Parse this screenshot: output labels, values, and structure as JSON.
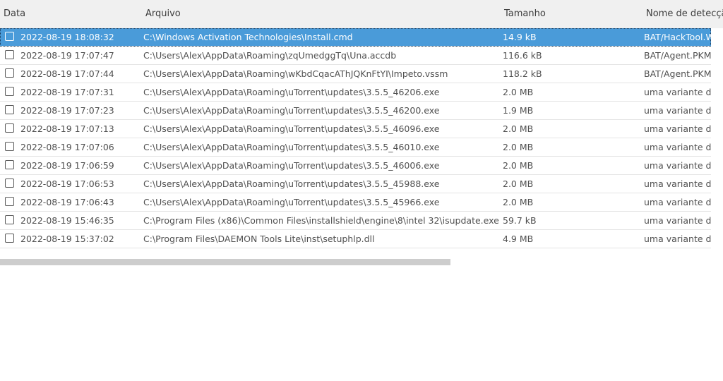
{
  "columns": {
    "date": "Data",
    "file": "Arquivo",
    "size": "Tamanho",
    "detection": "Nome de detecçã"
  },
  "rows": [
    {
      "date": "2022-08-19 18:08:32",
      "file": "C:\\Windows Activation Technologies\\Install.cmd",
      "size": "14.9 kB",
      "detection": "BAT/HackTool.W",
      "selected": true
    },
    {
      "date": "2022-08-19 17:07:47",
      "file": "C:\\Users\\Alex\\AppData\\Roaming\\zqUmedggTq\\Una.accdb",
      "size": "116.6 kB",
      "detection": "BAT/Agent.PKM"
    },
    {
      "date": "2022-08-19 17:07:44",
      "file": "C:\\Users\\Alex\\AppData\\Roaming\\wKbdCqacAThJQKnFtYI\\Impeto.vssm",
      "size": "118.2 kB",
      "detection": "BAT/Agent.PKM"
    },
    {
      "date": "2022-08-19 17:07:31",
      "file": "C:\\Users\\Alex\\AppData\\Roaming\\uTorrent\\updates\\3.5.5_46206.exe",
      "size": "2.0 MB",
      "detection": "uma variante de"
    },
    {
      "date": "2022-08-19 17:07:23",
      "file": "C:\\Users\\Alex\\AppData\\Roaming\\uTorrent\\updates\\3.5.5_46200.exe",
      "size": "1.9 MB",
      "detection": "uma variante de"
    },
    {
      "date": "2022-08-19 17:07:13",
      "file": "C:\\Users\\Alex\\AppData\\Roaming\\uTorrent\\updates\\3.5.5_46096.exe",
      "size": "2.0 MB",
      "detection": "uma variante de"
    },
    {
      "date": "2022-08-19 17:07:06",
      "file": "C:\\Users\\Alex\\AppData\\Roaming\\uTorrent\\updates\\3.5.5_46010.exe",
      "size": "2.0 MB",
      "detection": "uma variante de"
    },
    {
      "date": "2022-08-19 17:06:59",
      "file": "C:\\Users\\Alex\\AppData\\Roaming\\uTorrent\\updates\\3.5.5_46006.exe",
      "size": "2.0 MB",
      "detection": "uma variante de"
    },
    {
      "date": "2022-08-19 17:06:53",
      "file": "C:\\Users\\Alex\\AppData\\Roaming\\uTorrent\\updates\\3.5.5_45988.exe",
      "size": "2.0 MB",
      "detection": "uma variante de"
    },
    {
      "date": "2022-08-19 17:06:43",
      "file": "C:\\Users\\Alex\\AppData\\Roaming\\uTorrent\\updates\\3.5.5_45966.exe",
      "size": "2.0 MB",
      "detection": "uma variante de"
    },
    {
      "date": "2022-08-19 15:46:35",
      "file": "C:\\Program Files (x86)\\Common Files\\installshield\\engine\\8\\intel 32\\isupdate.exe",
      "size": "59.7 kB",
      "detection": "uma variante de"
    },
    {
      "date": "2022-08-19 15:37:02",
      "file": "C:\\Program Files\\DAEMON Tools Lite\\inst\\setuphlp.dll",
      "size": "4.9 MB",
      "detection": "uma variante de"
    }
  ],
  "colors": {
    "selection": "#4a9bd9",
    "header_bg": "#f0f0f0",
    "row_border": "#e4e4e4",
    "scrollbar": "#cdcdcd"
  }
}
